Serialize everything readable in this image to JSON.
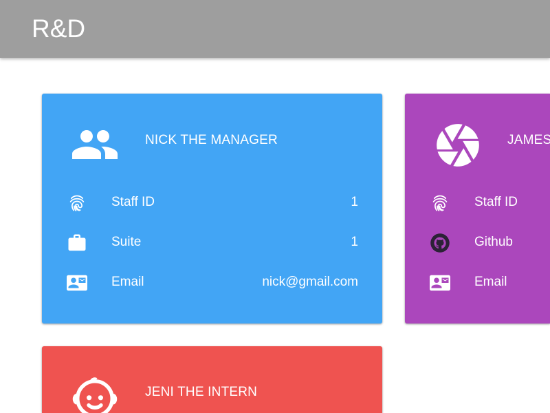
{
  "header": {
    "title": "R&D"
  },
  "colors": {
    "appbar": "#9e9e9e",
    "manager_card": "#42a5f5",
    "developer_card": "#ab47bc",
    "intern_card": "#ef5350",
    "github_mark": "#2b2236"
  },
  "cards": [
    {
      "name": "NICK THE MANAGER",
      "avatar_icon": "people-icon",
      "rows": [
        {
          "icon": "fingerprint-icon",
          "label": "Staff ID",
          "value": "1"
        },
        {
          "icon": "briefcase-icon",
          "label": "Suite",
          "value": "1"
        },
        {
          "icon": "contact-mail-icon",
          "label": "Email",
          "value": "nick@gmail.com"
        }
      ]
    },
    {
      "name": "JAMES",
      "avatar_icon": "camera-shutter-icon",
      "rows": [
        {
          "icon": "fingerprint-icon",
          "label": "Staff ID",
          "value": ""
        },
        {
          "icon": "github-icon",
          "label": "Github",
          "value": ""
        },
        {
          "icon": "contact-mail-icon",
          "label": "Email",
          "value": ""
        }
      ]
    },
    {
      "name": "JENI THE INTERN",
      "avatar_icon": "child-face-icon",
      "rows": []
    }
  ]
}
